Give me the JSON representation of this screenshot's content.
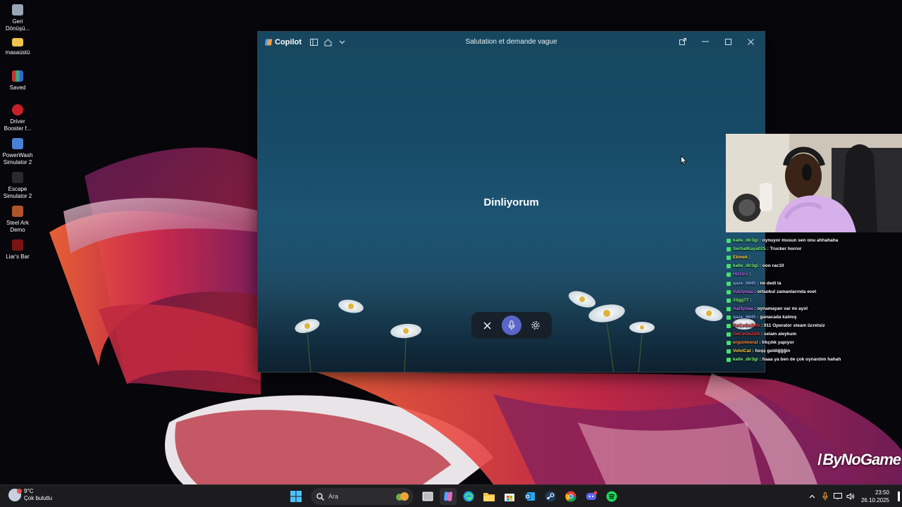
{
  "desktop": {
    "icons": [
      {
        "label": "Geri Dönüşü...",
        "icon": "recycle-bin-icon"
      },
      {
        "label": "masaüstü",
        "icon": "folder-icon"
      },
      {
        "label": "Saved",
        "icon": "winrar-icon"
      },
      {
        "label": "Driver Booster f...",
        "icon": "driver-booster-icon"
      },
      {
        "label": "PowerWash Simulator 2",
        "icon": "powerwash-icon"
      },
      {
        "label": "Escape Simulator 2",
        "icon": "escape-simulator-icon"
      },
      {
        "label": "Steel Ark Demo",
        "icon": "steel-ark-icon"
      },
      {
        "label": "Liar's Bar",
        "icon": "liars-bar-icon"
      }
    ]
  },
  "copilot": {
    "brand": "Copilot",
    "title": "Salutation et demande vague",
    "status_text": "Dinliyorum",
    "colors": {
      "mic_accent": "#5a66c9"
    }
  },
  "chat": [
    {
      "user": "kalle_dir3gi",
      "user_color": "#7fff7f",
      "message": ": oynuyor musun sen onu ahhahaha"
    },
    {
      "user": "SerhatKaya025",
      "user_color": "#7fff7f",
      "message": ": Trucker horror"
    },
    {
      "user": "Ekmek",
      "user_color": "#ffd84a",
      "message": ":"
    },
    {
      "user": "kalle_dir3gi",
      "user_color": "#7fff7f",
      "message": ": ooo rac10"
    },
    {
      "user": "HizOru",
      "user_color": "#b66bff",
      "message": ":"
    },
    {
      "user": "qaze_6845",
      "user_color": "#8fb6ff",
      "message": ": ne dedi la"
    },
    {
      "user": "Aal3ynaa",
      "user_color": "#c76bff",
      "message": ": ortaokul zamanlarında evet"
    },
    {
      "user": "33gg77",
      "user_color": "#7fff7f",
      "message": ":"
    },
    {
      "user": "Aal3ynaa",
      "user_color": "#c76bff",
      "message": ": oynamayan var mı ayol"
    },
    {
      "user": "qaze_6845",
      "user_color": "#8fb6ff",
      "message": ": ganacada kalmış"
    },
    {
      "user": "GeCeGeZeN",
      "user_color": "#ff3b3b",
      "message": ": 911 Operator steam ücretsiz"
    },
    {
      "user": "GeCeGeZeN",
      "user_color": "#ff3b3b",
      "message": ": selam aleykum"
    },
    {
      "user": "ergunmeral",
      "user_color": "#ff8a3b",
      "message": ": Irkçılık yapıyor"
    },
    {
      "user": "VolviCat",
      "user_color": "#ffd84a",
      "message": ": hoşş geldiğğğin"
    },
    {
      "user": "kalle_dir3gi",
      "user_color": "#7fff7f",
      "message": ": haaa ya ben de çok oynardım hahah"
    }
  ],
  "watermark": "ByNoGame",
  "taskbar": {
    "weather_temp": "9°C",
    "weather_desc": "Çok bulutlu",
    "search_placeholder": "Ara",
    "apps": [
      "start-icon",
      "task-view-icon",
      "copilot-icon",
      "edge-icon",
      "file-explorer-icon",
      "microsoft-store-icon",
      "outlook-icon",
      "steam-icon",
      "chrome-icon",
      "discord-icon",
      "spotify-icon"
    ],
    "time": "23:50",
    "date": "26.10.2025"
  }
}
